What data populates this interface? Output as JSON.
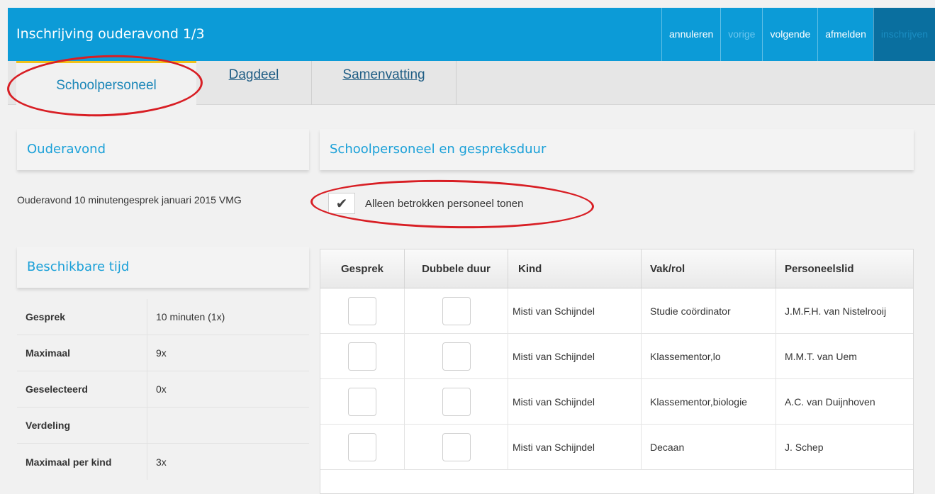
{
  "header": {
    "title": "Inschrijving ouderavond 1/3",
    "nav": {
      "cancel": "annuleren",
      "previous": "vorige",
      "next": "volgende",
      "logout": "afmelden",
      "register": "inschrijven"
    }
  },
  "tabs": {
    "schoolpersoneel": "Schoolpersoneel",
    "dagdeel": "Dagdeel",
    "samenvatting": "Samenvatting"
  },
  "ouderavond": {
    "heading": "Ouderavond",
    "description": "Ouderavond 10 minutengesprek januari 2015 VMG"
  },
  "beschikbaar": {
    "heading": "Beschikbare tijd",
    "rows": [
      {
        "label": "Gesprek",
        "value": "10 minuten (1x)"
      },
      {
        "label": "Maximaal",
        "value": "9x"
      },
      {
        "label": "Geselecteerd",
        "value": "0x"
      },
      {
        "label": "Verdeling",
        "value": ""
      },
      {
        "label": "Maximaal per kind",
        "value": "3x"
      }
    ]
  },
  "personeel": {
    "heading": "Schoolpersoneel en gespreksduur",
    "checkbox_label": "Alleen betrokken personeel tonen",
    "checkbox_mark": "✔",
    "columns": {
      "gesprek": "Gesprek",
      "dubbele": "Dubbele duur",
      "kind": "Kind",
      "vak": "Vak/rol",
      "personeelslid": "Personeelslid"
    },
    "rows": [
      {
        "kind": "Misti van Schijndel",
        "vak": "Studie coördinator",
        "personeelslid": "J.M.F.H. van Nistelrooij"
      },
      {
        "kind": "Misti van Schijndel",
        "vak": "Klassementor,lo",
        "personeelslid": "M.M.T. van Uem"
      },
      {
        "kind": "Misti van Schijndel",
        "vak": "Klassementor,biologie",
        "personeelslid": "A.C. van Duijnhoven"
      },
      {
        "kind": "Misti van Schijndel",
        "vak": "Decaan",
        "personeelslid": "J. Schep"
      }
    ]
  },
  "colors": {
    "header_bg": "#0c9bd7",
    "accent_text": "#1aa0d8",
    "annotation": "#d81e24",
    "active_tab_border": "#f0c21a"
  }
}
